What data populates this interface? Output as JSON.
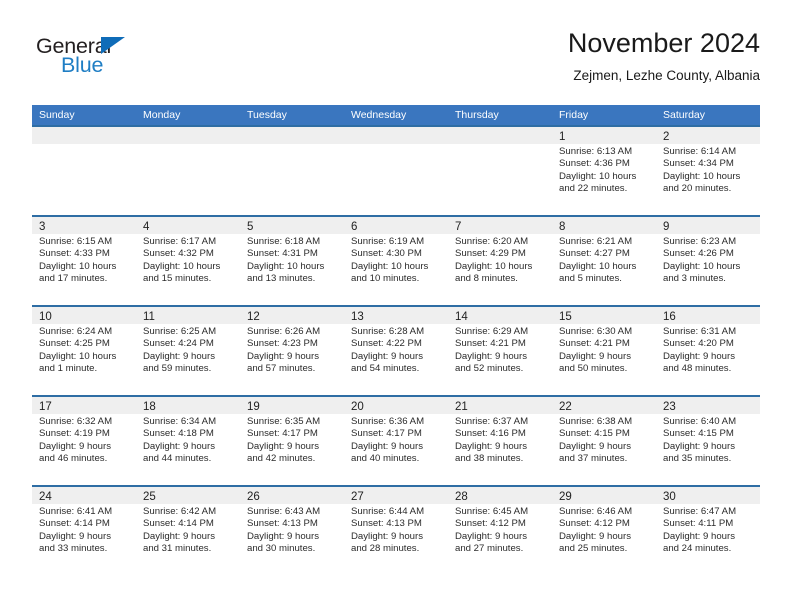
{
  "brand": {
    "name_top": "General",
    "name_bottom": "Blue",
    "triangle_color": "#0f6cb8",
    "blue_color": "#1f7ec4"
  },
  "header": {
    "title": "November 2024",
    "subtitle": "Zejmen, Lezhe County, Albania"
  },
  "theme": {
    "header_blue": "#3a76bf",
    "row_divider_blue": "#2e6da4",
    "day_band_gray": "#efefef"
  },
  "weekdays": [
    "Sunday",
    "Monday",
    "Tuesday",
    "Wednesday",
    "Thursday",
    "Friday",
    "Saturday"
  ],
  "weeks": [
    [
      {
        "day": "",
        "sunrise": "",
        "sunset": "",
        "daylight_1": "",
        "daylight_2": ""
      },
      {
        "day": "",
        "sunrise": "",
        "sunset": "",
        "daylight_1": "",
        "daylight_2": ""
      },
      {
        "day": "",
        "sunrise": "",
        "sunset": "",
        "daylight_1": "",
        "daylight_2": ""
      },
      {
        "day": "",
        "sunrise": "",
        "sunset": "",
        "daylight_1": "",
        "daylight_2": ""
      },
      {
        "day": "",
        "sunrise": "",
        "sunset": "",
        "daylight_1": "",
        "daylight_2": ""
      },
      {
        "day": "1",
        "sunrise": "Sunrise: 6:13 AM",
        "sunset": "Sunset: 4:36 PM",
        "daylight_1": "Daylight: 10 hours",
        "daylight_2": "and 22 minutes."
      },
      {
        "day": "2",
        "sunrise": "Sunrise: 6:14 AM",
        "sunset": "Sunset: 4:34 PM",
        "daylight_1": "Daylight: 10 hours",
        "daylight_2": "and 20 minutes."
      }
    ],
    [
      {
        "day": "3",
        "sunrise": "Sunrise: 6:15 AM",
        "sunset": "Sunset: 4:33 PM",
        "daylight_1": "Daylight: 10 hours",
        "daylight_2": "and 17 minutes."
      },
      {
        "day": "4",
        "sunrise": "Sunrise: 6:17 AM",
        "sunset": "Sunset: 4:32 PM",
        "daylight_1": "Daylight: 10 hours",
        "daylight_2": "and 15 minutes."
      },
      {
        "day": "5",
        "sunrise": "Sunrise: 6:18 AM",
        "sunset": "Sunset: 4:31 PM",
        "daylight_1": "Daylight: 10 hours",
        "daylight_2": "and 13 minutes."
      },
      {
        "day": "6",
        "sunrise": "Sunrise: 6:19 AM",
        "sunset": "Sunset: 4:30 PM",
        "daylight_1": "Daylight: 10 hours",
        "daylight_2": "and 10 minutes."
      },
      {
        "day": "7",
        "sunrise": "Sunrise: 6:20 AM",
        "sunset": "Sunset: 4:29 PM",
        "daylight_1": "Daylight: 10 hours",
        "daylight_2": "and 8 minutes."
      },
      {
        "day": "8",
        "sunrise": "Sunrise: 6:21 AM",
        "sunset": "Sunset: 4:27 PM",
        "daylight_1": "Daylight: 10 hours",
        "daylight_2": "and 5 minutes."
      },
      {
        "day": "9",
        "sunrise": "Sunrise: 6:23 AM",
        "sunset": "Sunset: 4:26 PM",
        "daylight_1": "Daylight: 10 hours",
        "daylight_2": "and 3 minutes."
      }
    ],
    [
      {
        "day": "10",
        "sunrise": "Sunrise: 6:24 AM",
        "sunset": "Sunset: 4:25 PM",
        "daylight_1": "Daylight: 10 hours",
        "daylight_2": "and 1 minute."
      },
      {
        "day": "11",
        "sunrise": "Sunrise: 6:25 AM",
        "sunset": "Sunset: 4:24 PM",
        "daylight_1": "Daylight: 9 hours",
        "daylight_2": "and 59 minutes."
      },
      {
        "day": "12",
        "sunrise": "Sunrise: 6:26 AM",
        "sunset": "Sunset: 4:23 PM",
        "daylight_1": "Daylight: 9 hours",
        "daylight_2": "and 57 minutes."
      },
      {
        "day": "13",
        "sunrise": "Sunrise: 6:28 AM",
        "sunset": "Sunset: 4:22 PM",
        "daylight_1": "Daylight: 9 hours",
        "daylight_2": "and 54 minutes."
      },
      {
        "day": "14",
        "sunrise": "Sunrise: 6:29 AM",
        "sunset": "Sunset: 4:21 PM",
        "daylight_1": "Daylight: 9 hours",
        "daylight_2": "and 52 minutes."
      },
      {
        "day": "15",
        "sunrise": "Sunrise: 6:30 AM",
        "sunset": "Sunset: 4:21 PM",
        "daylight_1": "Daylight: 9 hours",
        "daylight_2": "and 50 minutes."
      },
      {
        "day": "16",
        "sunrise": "Sunrise: 6:31 AM",
        "sunset": "Sunset: 4:20 PM",
        "daylight_1": "Daylight: 9 hours",
        "daylight_2": "and 48 minutes."
      }
    ],
    [
      {
        "day": "17",
        "sunrise": "Sunrise: 6:32 AM",
        "sunset": "Sunset: 4:19 PM",
        "daylight_1": "Daylight: 9 hours",
        "daylight_2": "and 46 minutes."
      },
      {
        "day": "18",
        "sunrise": "Sunrise: 6:34 AM",
        "sunset": "Sunset: 4:18 PM",
        "daylight_1": "Daylight: 9 hours",
        "daylight_2": "and 44 minutes."
      },
      {
        "day": "19",
        "sunrise": "Sunrise: 6:35 AM",
        "sunset": "Sunset: 4:17 PM",
        "daylight_1": "Daylight: 9 hours",
        "daylight_2": "and 42 minutes."
      },
      {
        "day": "20",
        "sunrise": "Sunrise: 6:36 AM",
        "sunset": "Sunset: 4:17 PM",
        "daylight_1": "Daylight: 9 hours",
        "daylight_2": "and 40 minutes."
      },
      {
        "day": "21",
        "sunrise": "Sunrise: 6:37 AM",
        "sunset": "Sunset: 4:16 PM",
        "daylight_1": "Daylight: 9 hours",
        "daylight_2": "and 38 minutes."
      },
      {
        "day": "22",
        "sunrise": "Sunrise: 6:38 AM",
        "sunset": "Sunset: 4:15 PM",
        "daylight_1": "Daylight: 9 hours",
        "daylight_2": "and 37 minutes."
      },
      {
        "day": "23",
        "sunrise": "Sunrise: 6:40 AM",
        "sunset": "Sunset: 4:15 PM",
        "daylight_1": "Daylight: 9 hours",
        "daylight_2": "and 35 minutes."
      }
    ],
    [
      {
        "day": "24",
        "sunrise": "Sunrise: 6:41 AM",
        "sunset": "Sunset: 4:14 PM",
        "daylight_1": "Daylight: 9 hours",
        "daylight_2": "and 33 minutes."
      },
      {
        "day": "25",
        "sunrise": "Sunrise: 6:42 AM",
        "sunset": "Sunset: 4:14 PM",
        "daylight_1": "Daylight: 9 hours",
        "daylight_2": "and 31 minutes."
      },
      {
        "day": "26",
        "sunrise": "Sunrise: 6:43 AM",
        "sunset": "Sunset: 4:13 PM",
        "daylight_1": "Daylight: 9 hours",
        "daylight_2": "and 30 minutes."
      },
      {
        "day": "27",
        "sunrise": "Sunrise: 6:44 AM",
        "sunset": "Sunset: 4:13 PM",
        "daylight_1": "Daylight: 9 hours",
        "daylight_2": "and 28 minutes."
      },
      {
        "day": "28",
        "sunrise": "Sunrise: 6:45 AM",
        "sunset": "Sunset: 4:12 PM",
        "daylight_1": "Daylight: 9 hours",
        "daylight_2": "and 27 minutes."
      },
      {
        "day": "29",
        "sunrise": "Sunrise: 6:46 AM",
        "sunset": "Sunset: 4:12 PM",
        "daylight_1": "Daylight: 9 hours",
        "daylight_2": "and 25 minutes."
      },
      {
        "day": "30",
        "sunrise": "Sunrise: 6:47 AM",
        "sunset": "Sunset: 4:11 PM",
        "daylight_1": "Daylight: 9 hours",
        "daylight_2": "and 24 minutes."
      }
    ]
  ]
}
